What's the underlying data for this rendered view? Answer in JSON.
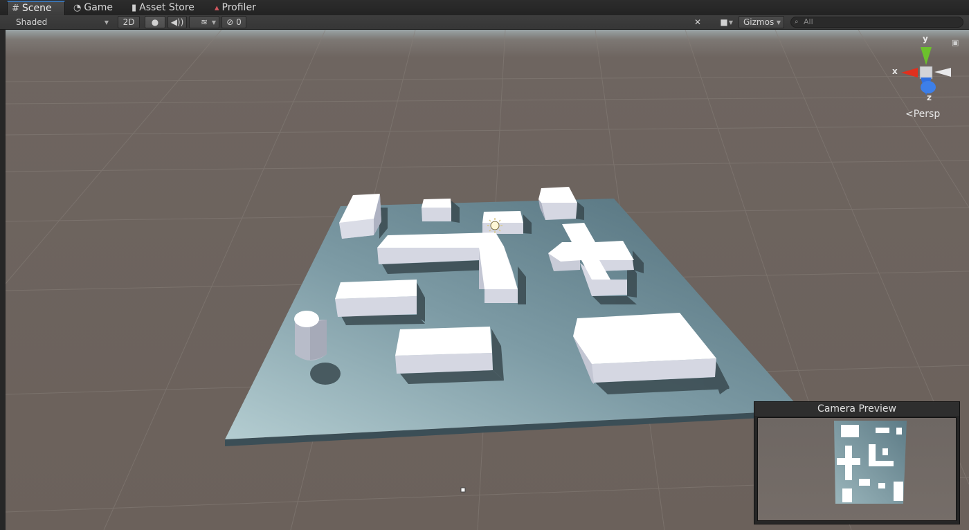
{
  "tabs": [
    {
      "label": "Scene",
      "icon": "grid-icon",
      "active": true
    },
    {
      "label": "Game",
      "icon": "pacman-icon",
      "active": false
    },
    {
      "label": "Asset Store",
      "icon": "store-bag-icon",
      "active": false
    },
    {
      "label": "Profiler",
      "icon": "profiler-icon",
      "active": false
    }
  ],
  "toolbar": {
    "shading_mode": "Shaded",
    "mode_2d": "2D",
    "hidden_count": "0",
    "gizmos": "Gizmos",
    "search_placeholder": "All"
  },
  "gizmo": {
    "x_label": "x",
    "y_label": "y",
    "z_label": "z",
    "projection": "Persp",
    "colors": {
      "x": "#e0301e",
      "y": "#6cc02c",
      "z": "#2f6fe0"
    }
  },
  "camera_preview": {
    "title": "Camera Preview"
  },
  "colors": {
    "ground": "#6b615b",
    "plane": "#5f7f8a",
    "box_top": "#ffffff",
    "box_side": "#c9ccd8",
    "active_tab_accent": "#3a72b0"
  }
}
